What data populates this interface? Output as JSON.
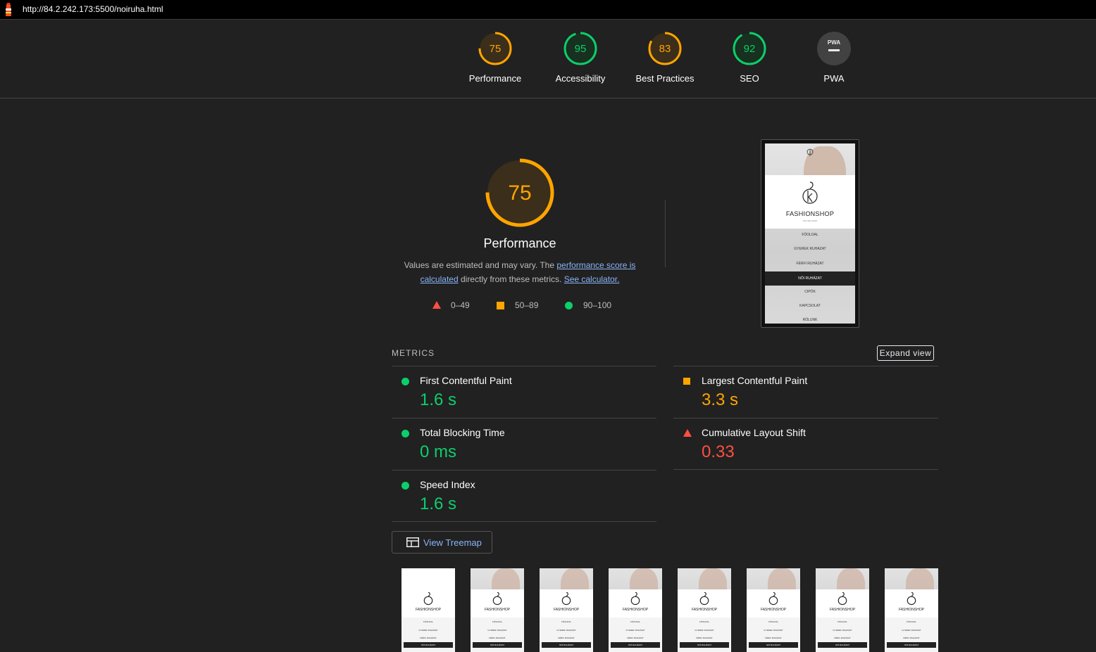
{
  "url_bar": {
    "url": "http://84.2.242.173:5500/noiruha.html"
  },
  "header": {
    "gauges": [
      {
        "label": "Performance",
        "score": "75",
        "status": "average"
      },
      {
        "label": "Accessibility",
        "score": "95",
        "status": "pass"
      },
      {
        "label": "Best Practices",
        "score": "83",
        "status": "average"
      },
      {
        "label": "SEO",
        "score": "92",
        "status": "pass"
      },
      {
        "label": "PWA",
        "score": "PWA",
        "status": "na"
      }
    ]
  },
  "performance": {
    "score": "75",
    "score_fraction": 0.75,
    "title": "Performance",
    "desc_prefix": "Values are estimated and may vary. The ",
    "link_score": "performance score is calculated",
    "desc_middle": " directly from these metrics. ",
    "link_calc": "See calculator.",
    "legend": [
      {
        "range": "0–49",
        "shape": "triangle",
        "color": "#ff4e42"
      },
      {
        "range": "50–89",
        "shape": "square",
        "color": "#ffa400"
      },
      {
        "range": "90–100",
        "shape": "circle",
        "color": "#0cce6b"
      }
    ]
  },
  "screenshot": {
    "brand": "FASHIONSHOP",
    "tagline": "ONLINE SHOP",
    "menu": [
      "FŐOLDAL",
      "GYEREK RUHÁZAT",
      "FÉRFI RUHÁZAT",
      "NŐI RUHÁZAT",
      "CIPŐK",
      "KAPCSOLAT",
      "RÓLUNK"
    ]
  },
  "metrics": {
    "label": "METRICS",
    "expand": "Expand view",
    "items": [
      {
        "title": "First Contentful Paint",
        "value": "1.6 s",
        "status": "pass"
      },
      {
        "title": "Largest Contentful Paint",
        "value": "3.3 s",
        "status": "average"
      },
      {
        "title": "Total Blocking Time",
        "value": "0 ms",
        "status": "pass"
      },
      {
        "title": "Cumulative Layout Shift",
        "value": "0.33",
        "status": "fail"
      },
      {
        "title": "Speed Index",
        "value": "1.6 s",
        "status": "pass"
      }
    ]
  },
  "treemap": {
    "label": "View Treemap"
  },
  "colors": {
    "pass": "#0cce6b",
    "average": "#ffa400",
    "fail": "#ff4e42",
    "link": "#8ab4f8",
    "background": "#212121"
  }
}
